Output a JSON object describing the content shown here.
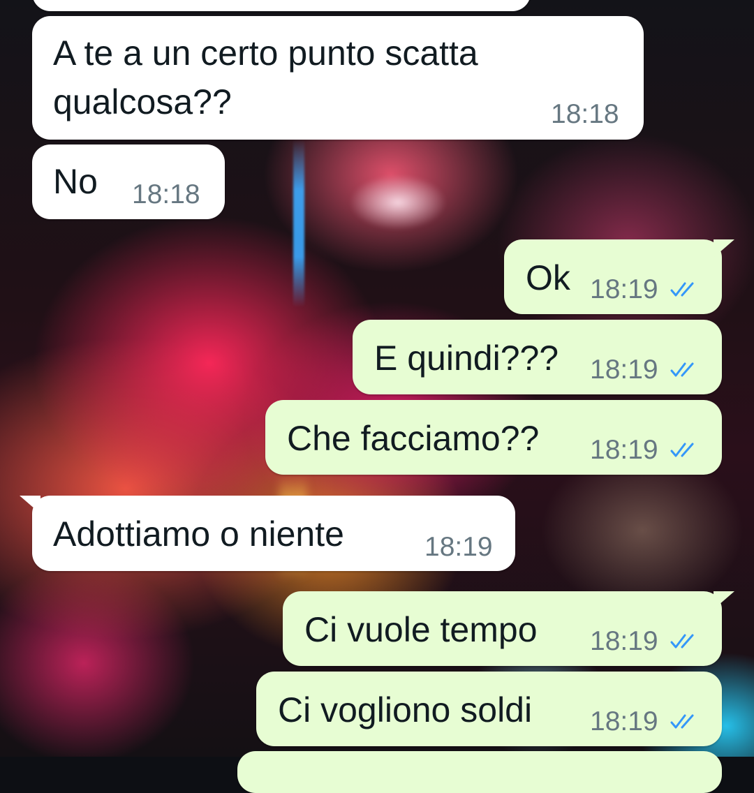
{
  "chat": {
    "tick_color": "#3497f9",
    "incoming_bubble_color": "#ffffff",
    "outgoing_bubble_color": "#e7fdd3",
    "messages": [
      {
        "direction": "incoming",
        "text_line1": "A te a un certo punto scatta",
        "text_line2": "qualcosa??",
        "time": "18:18"
      },
      {
        "direction": "incoming",
        "text": "No",
        "time": "18:18"
      },
      {
        "direction": "outgoing",
        "text": "Ok",
        "time": "18:19",
        "status": "read-double-check-icon"
      },
      {
        "direction": "outgoing",
        "text": "E quindi???",
        "time": "18:19",
        "status": "read-double-check-icon"
      },
      {
        "direction": "outgoing",
        "text": "Che facciamo??",
        "time": "18:19",
        "status": "read-double-check-icon"
      },
      {
        "direction": "incoming",
        "text": "Adottiamo o niente",
        "time": "18:19"
      },
      {
        "direction": "outgoing",
        "text": "Ci vuole tempo",
        "time": "18:19",
        "status": "read-double-check-icon"
      },
      {
        "direction": "outgoing",
        "text": "Ci vogliono soldi",
        "time": "18:19",
        "status": "read-double-check-icon"
      }
    ]
  }
}
